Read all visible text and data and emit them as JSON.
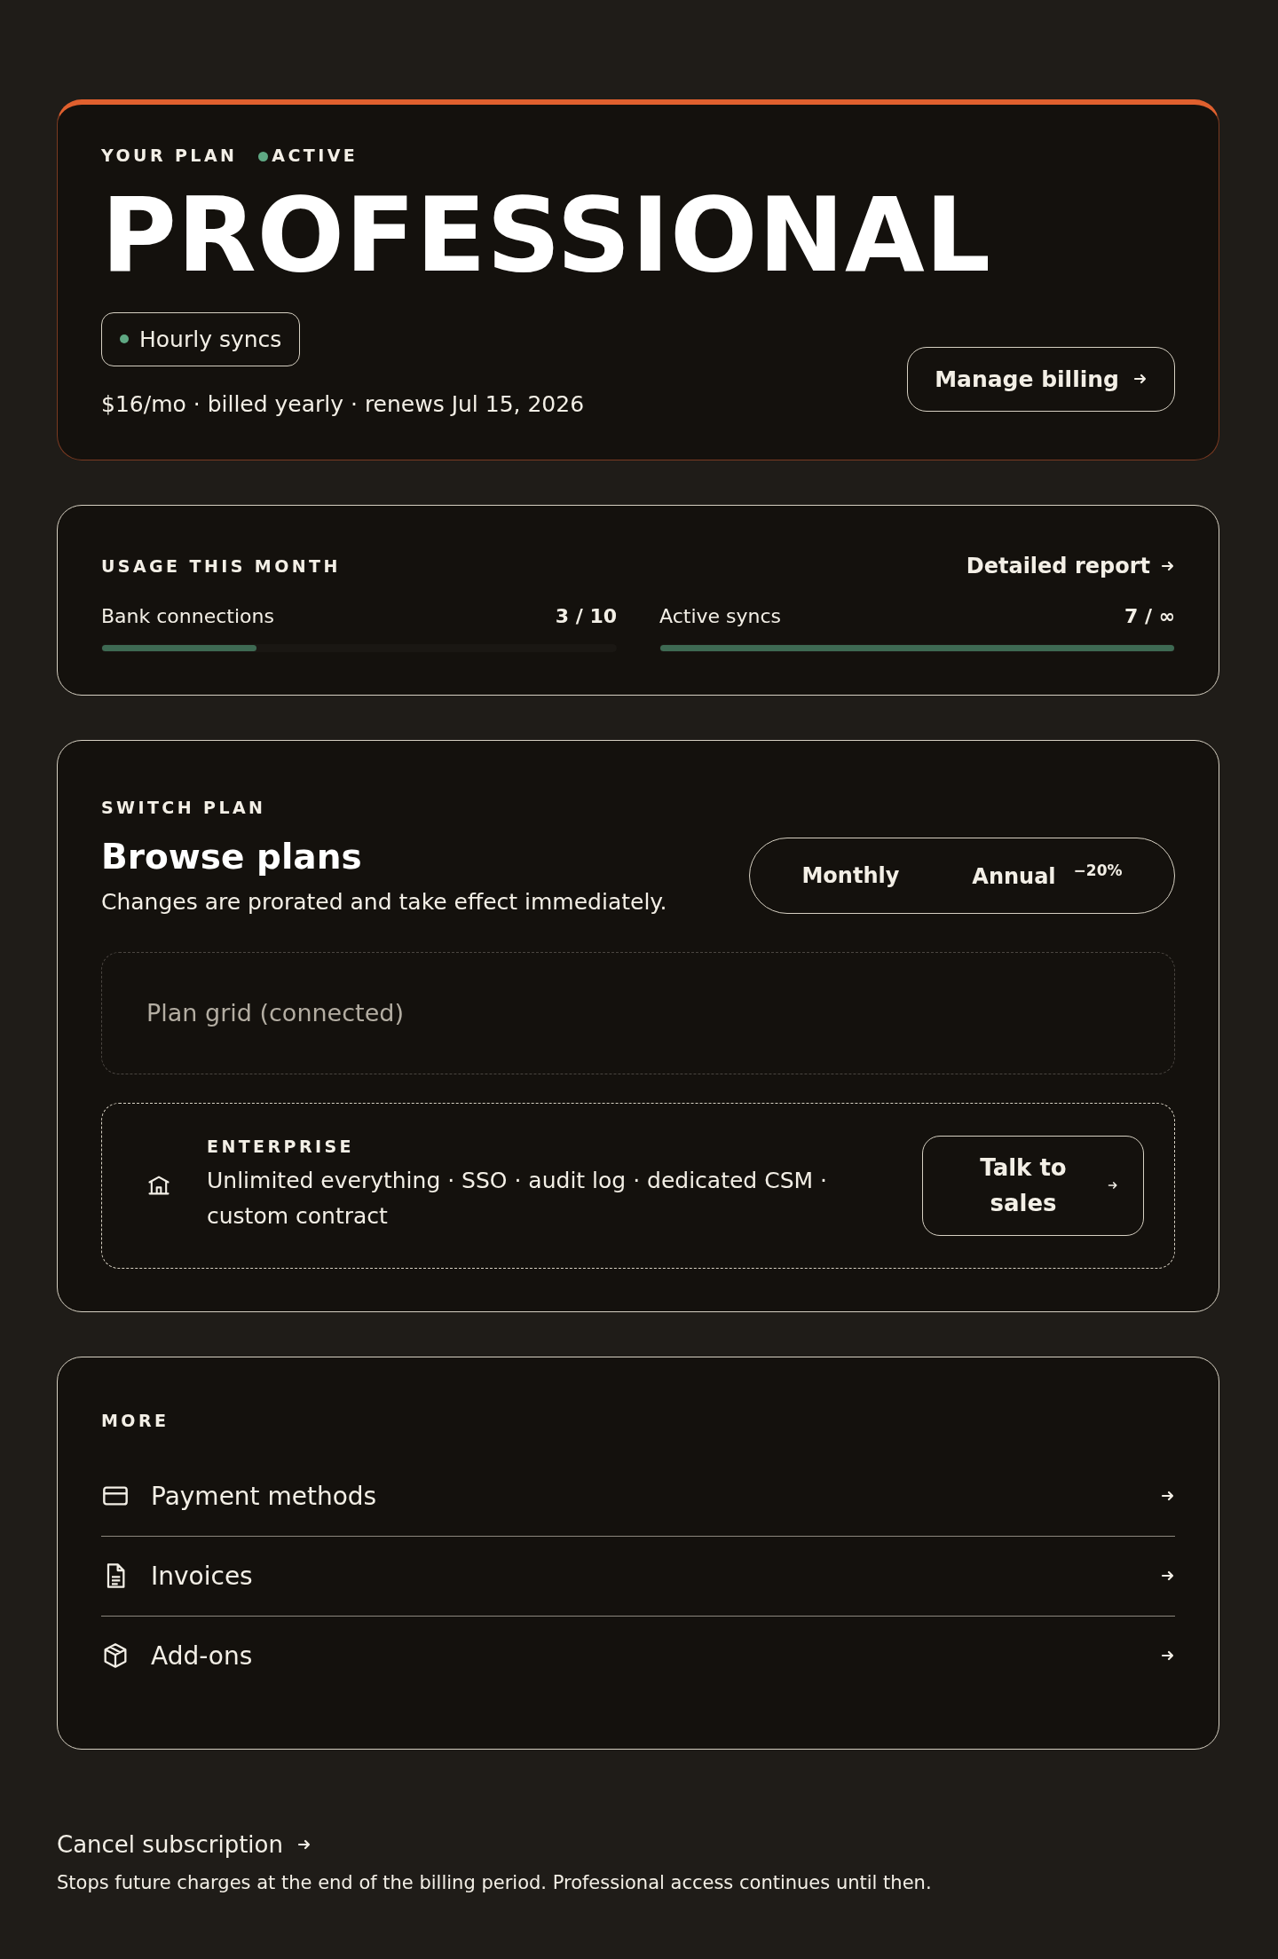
{
  "plan": {
    "label": "YOUR PLAN",
    "status": "ACTIVE",
    "name": "PROFESSIONAL",
    "tag": "Hourly syncs",
    "price_line": "$16/mo · billed yearly · renews Jul 15, 2026",
    "button": "Manage billing"
  },
  "usage": {
    "label": "USAGE THIS MONTH",
    "link": "Detailed report",
    "meters": [
      {
        "name": "Bank connections",
        "reading": "3 / 10",
        "level": 0.3
      },
      {
        "name": "Active syncs",
        "reading": "7 / ∞",
        "level": 1
      }
    ]
  },
  "switch_plan": {
    "label": "SWITCH PLAN",
    "title": "Browse plans",
    "subtitle": "Changes are prorated and take effect immediately.",
    "billing_toggle": [
      {
        "label": "Monthly",
        "selected": false
      },
      {
        "label": "Annual",
        "badge": "−20%",
        "selected": false
      }
    ],
    "plan_grid": {
      "placeholder": "Plan grid (connected)"
    },
    "enterprise": {
      "label": "ENTERPRISE",
      "description": "Unlimited everything · SSO · audit log · dedicated CSM · custom contract",
      "button": "Talk to sales"
    }
  },
  "more": {
    "label": "MORE",
    "items": [
      {
        "kind": "card",
        "label": "Payment methods"
      },
      {
        "kind": "document",
        "label": "Invoices"
      },
      {
        "kind": "box",
        "label": "Add-ons"
      }
    ]
  },
  "cancel": {
    "link": "Cancel subscription",
    "note": "Stops future charges at the end of the billing period. Professional access continues until then."
  }
}
